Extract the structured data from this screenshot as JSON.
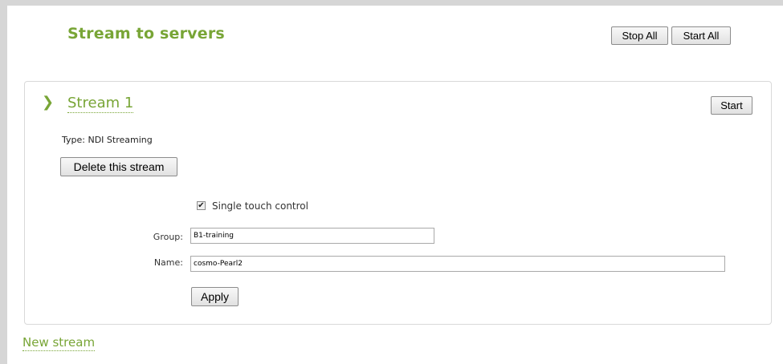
{
  "page": {
    "title": "Stream to servers",
    "stop_all_label": "Stop All",
    "start_all_label": "Start All",
    "accent_color": "#78a536"
  },
  "stream": {
    "title": "Stream 1",
    "expand_icon": "chevron-down-icon",
    "start_label": "Start",
    "type_text": "Type: NDI Streaming",
    "delete_label": "Delete this stream",
    "single_touch": {
      "label": "Single touch control",
      "checked": true
    },
    "group": {
      "label": "Group:",
      "value": "B1-training"
    },
    "name": {
      "label": "Name:",
      "value": "cosmo-Pearl2"
    },
    "apply_label": "Apply"
  },
  "footer": {
    "new_stream_label": "New stream"
  }
}
